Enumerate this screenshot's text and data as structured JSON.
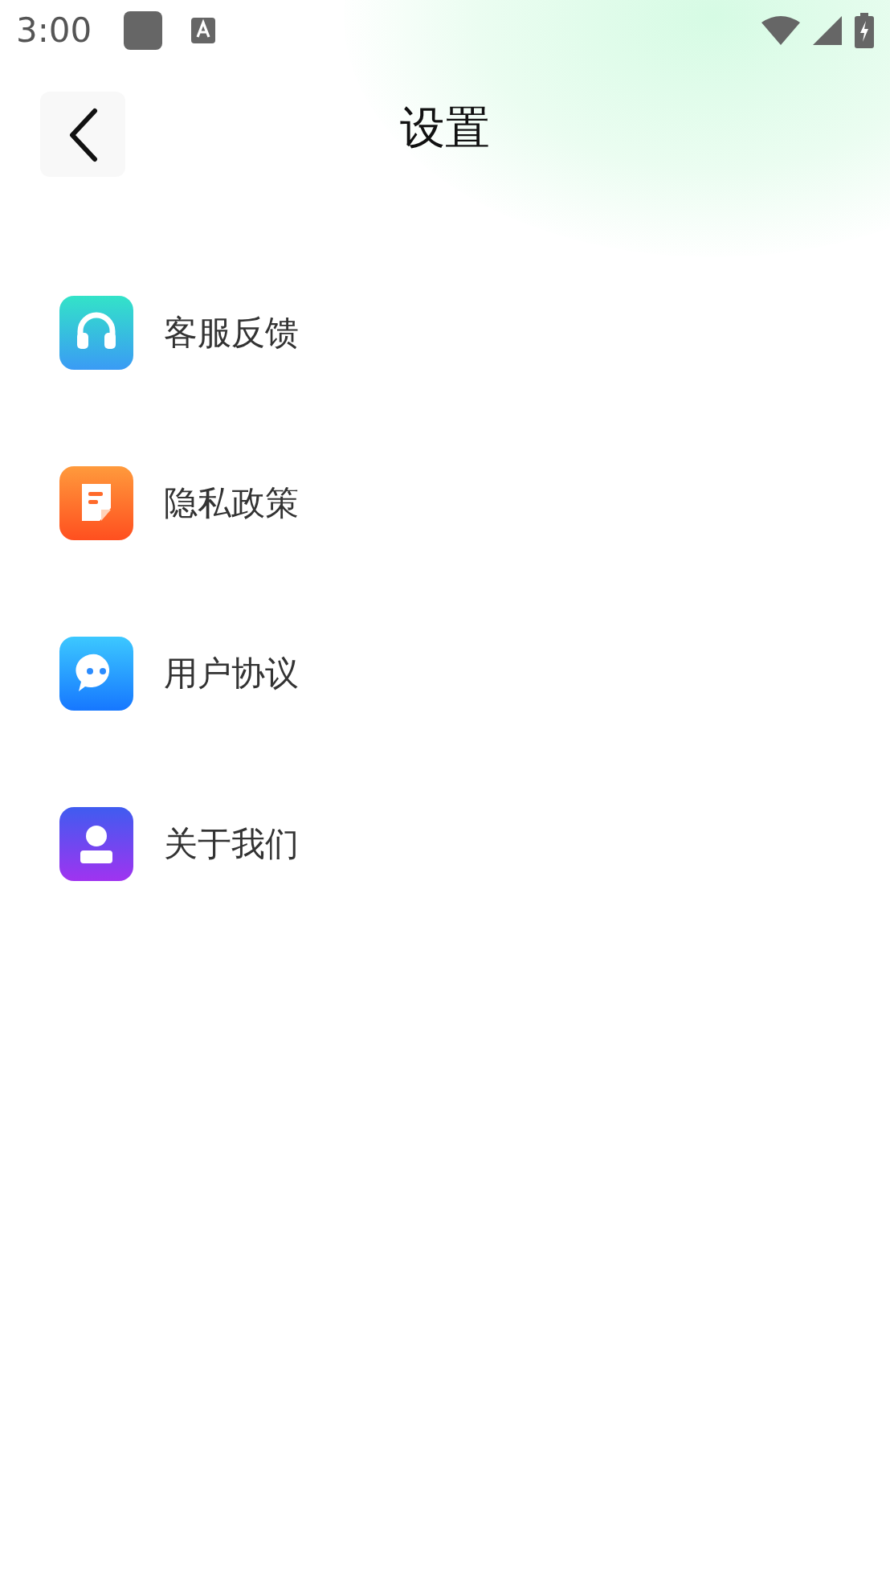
{
  "status_bar": {
    "time": "3:00"
  },
  "header": {
    "title": "设置"
  },
  "items": [
    {
      "label": "客服反馈",
      "kind": "headset"
    },
    {
      "label": "隐私政策",
      "kind": "document"
    },
    {
      "label": "用户协议",
      "kind": "chat"
    },
    {
      "label": "关于我们",
      "kind": "person"
    }
  ]
}
